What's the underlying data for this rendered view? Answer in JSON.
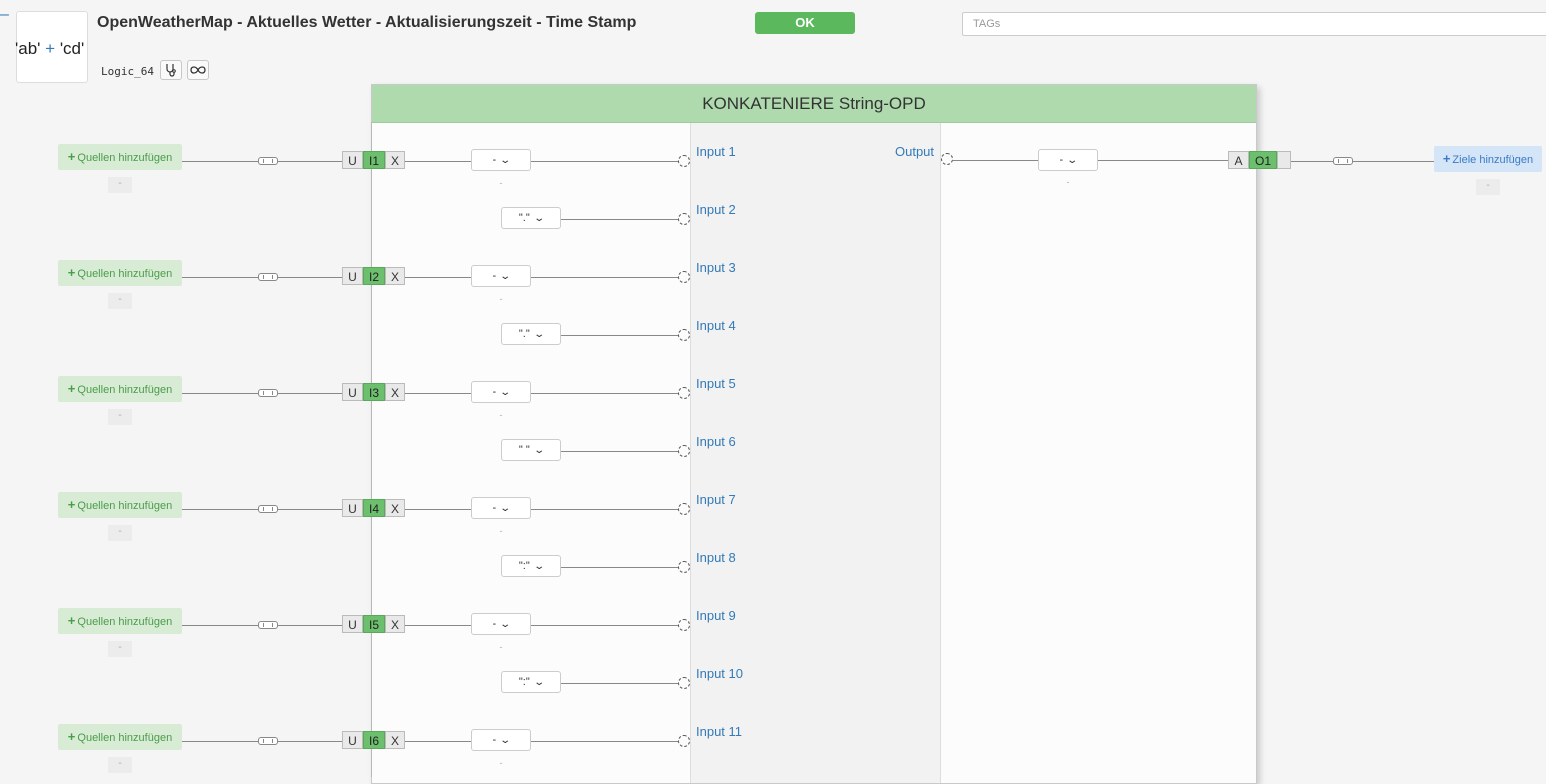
{
  "header": {
    "title": "OpenWeatherMap - Aktuelles Wetter - Aktualisierungszeit - Time Stamp",
    "logic_id": "Logic_64",
    "logo": {
      "left": "'ab'",
      "op": "+",
      "right": "'cd'"
    },
    "ok_label": "OK",
    "tags_placeholder": "TAGs",
    "collapse": "–",
    "icons": [
      "stethoscope-icon",
      "infinity-icon"
    ]
  },
  "block": {
    "title": "KONKATENIERE String-OPD",
    "output_label": "Output",
    "output_select": "-",
    "output_port": {
      "left": "A",
      "id": "O1"
    },
    "target_label": "Ziele hinzufügen",
    "dash": "-"
  },
  "sources": [
    {
      "label": "Quellen hinzufügen",
      "port": "I1",
      "u": "U",
      "x": "X",
      "select": "-",
      "dash": "-"
    },
    {
      "label": "Quellen hinzufügen",
      "port": "I2",
      "u": "U",
      "x": "X",
      "select": "-",
      "dash": "-"
    },
    {
      "label": "Quellen hinzufügen",
      "port": "I3",
      "u": "U",
      "x": "X",
      "select": "-",
      "dash": "-"
    },
    {
      "label": "Quellen hinzufügen",
      "port": "I4",
      "u": "U",
      "x": "X",
      "select": "-",
      "dash": "-"
    },
    {
      "label": "Quellen hinzufügen",
      "port": "I5",
      "u": "U",
      "x": "X",
      "select": "-",
      "dash": "-"
    },
    {
      "label": "Quellen hinzufügen",
      "port": "I6",
      "u": "U",
      "x": "X",
      "select": "-",
      "dash": "-"
    }
  ],
  "inputs": [
    {
      "label": "Input 1"
    },
    {
      "label": "Input 2",
      "constant": "\".\""
    },
    {
      "label": "Input 3"
    },
    {
      "label": "Input 4",
      "constant": "\".\""
    },
    {
      "label": "Input 5"
    },
    {
      "label": "Input 6",
      "constant": "\" \""
    },
    {
      "label": "Input 7"
    },
    {
      "label": "Input 8",
      "constant": "\":\""
    },
    {
      "label": "Input 9"
    },
    {
      "label": "Input 10",
      "constant": "\":\""
    },
    {
      "label": "Input 11"
    }
  ],
  "colors": {
    "ok": "#5cb85c",
    "block_header": "#aedaae",
    "port_active": "#6cbf6c",
    "link": "#337ab7",
    "source_bg": "#d8ecd5",
    "target_bg": "#d3e5f6"
  }
}
